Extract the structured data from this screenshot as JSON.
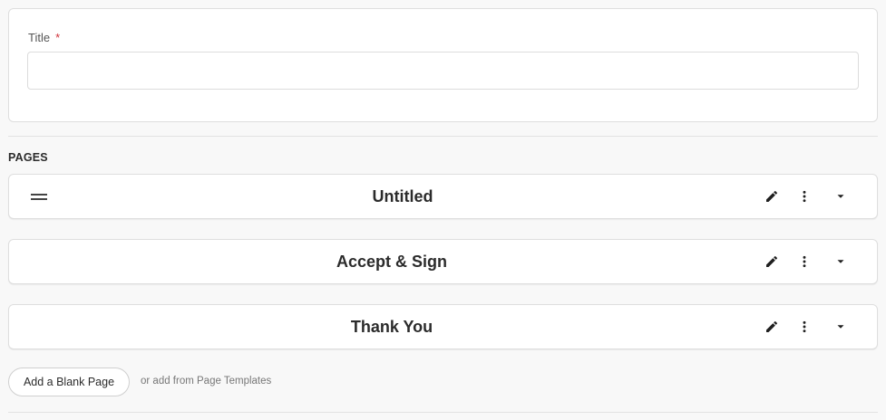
{
  "form": {
    "title_label": "Title",
    "required_marker": "*",
    "title_value": "",
    "title_placeholder": ""
  },
  "pages_section": {
    "heading": "PAGES",
    "items": [
      {
        "name": "Untitled",
        "draggable": true
      },
      {
        "name": "Accept & Sign",
        "draggable": false
      },
      {
        "name": "Thank You",
        "draggable": false
      }
    ],
    "icons": [
      "pencil-icon",
      "more-vertical-icon",
      "caret-down-icon",
      "drag-handle-icon"
    ]
  },
  "actions": {
    "add_blank_label": "Add a Blank Page",
    "add_from_templates_label": "or add from Page Templates"
  },
  "colors": {
    "background": "#f8f8f8",
    "card": "#ffffff",
    "border": "#dedede",
    "required": "#d0323b",
    "text": "#2b2b2b",
    "muted": "#777777"
  }
}
